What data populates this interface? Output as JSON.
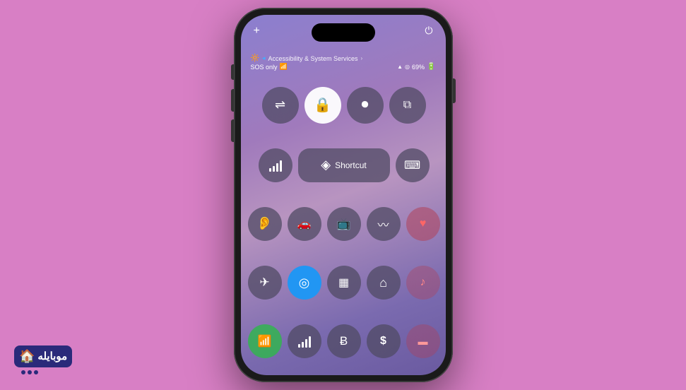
{
  "background_color": "#d87fc5",
  "phone": {
    "status_bar": {
      "sos_text": "SOS only",
      "wifi_icon": "wifi",
      "signal_text": "69%",
      "location_icon": "◂",
      "battery_icon": "🔋"
    },
    "header": {
      "accessibility_text": "Accessibility & System Services",
      "arrow": "›",
      "icon1": "🔆",
      "icon2": "◂"
    },
    "top_row": {
      "plus": "+",
      "power": "⏻"
    },
    "rows": [
      {
        "id": "row1",
        "buttons": [
          {
            "id": "orientation-lock",
            "icon": "⇌",
            "label": "Orientation Lock",
            "active": false
          },
          {
            "id": "screen-lock",
            "icon": "🔒",
            "label": "Screen Lock",
            "active": true,
            "style": "white"
          },
          {
            "id": "screen-record",
            "icon": "⏺",
            "label": "Screen Record",
            "active": false
          },
          {
            "id": "screen-mirror",
            "icon": "⧉",
            "label": "Screen Mirror",
            "active": false
          }
        ]
      },
      {
        "id": "row2",
        "buttons": [
          {
            "id": "signal-strength",
            "icon": "bars",
            "label": "Signal"
          },
          {
            "id": "shortcut",
            "icon": "◈",
            "label": "Shortcut",
            "type": "wide"
          },
          {
            "id": "keyboard",
            "icon": "⌨",
            "label": "Keyboard"
          }
        ]
      },
      {
        "id": "row3",
        "buttons": [
          {
            "id": "hearing",
            "icon": "👂",
            "label": "Hearing"
          },
          {
            "id": "driver-focus",
            "icon": "🚗",
            "label": "Driver Focus"
          },
          {
            "id": "remote",
            "icon": "📺",
            "label": "Remote"
          },
          {
            "id": "soundwave",
            "icon": "〰",
            "label": "Sound Wave"
          },
          {
            "id": "heart",
            "icon": "♥",
            "label": "Heart Rate"
          }
        ]
      },
      {
        "id": "row4",
        "buttons": [
          {
            "id": "airplane",
            "icon": "✈",
            "label": "Airplane Mode"
          },
          {
            "id": "airdrop",
            "icon": "◎",
            "label": "AirDrop",
            "active": true,
            "style": "blue"
          },
          {
            "id": "calculator",
            "icon": "▦",
            "label": "Calculator"
          },
          {
            "id": "home",
            "icon": "⌂",
            "label": "Home"
          },
          {
            "id": "music-side",
            "icon": "♪",
            "label": "Music"
          }
        ]
      },
      {
        "id": "row5",
        "buttons": [
          {
            "id": "wifi",
            "icon": "wifi",
            "label": "WiFi",
            "active": true,
            "style": "green"
          },
          {
            "id": "signal-bars2",
            "icon": "bars",
            "label": "Signal"
          },
          {
            "id": "bluetooth",
            "icon": "Ƀ",
            "label": "Bluetooth"
          },
          {
            "id": "wallet",
            "icon": "$",
            "label": "Wallet"
          },
          {
            "id": "card",
            "icon": "▬",
            "label": "Card"
          }
        ]
      }
    ],
    "shortcut_label": "Shortcut"
  },
  "logo": {
    "text": "موبایله",
    "brand_color": "#2a2a7a"
  }
}
